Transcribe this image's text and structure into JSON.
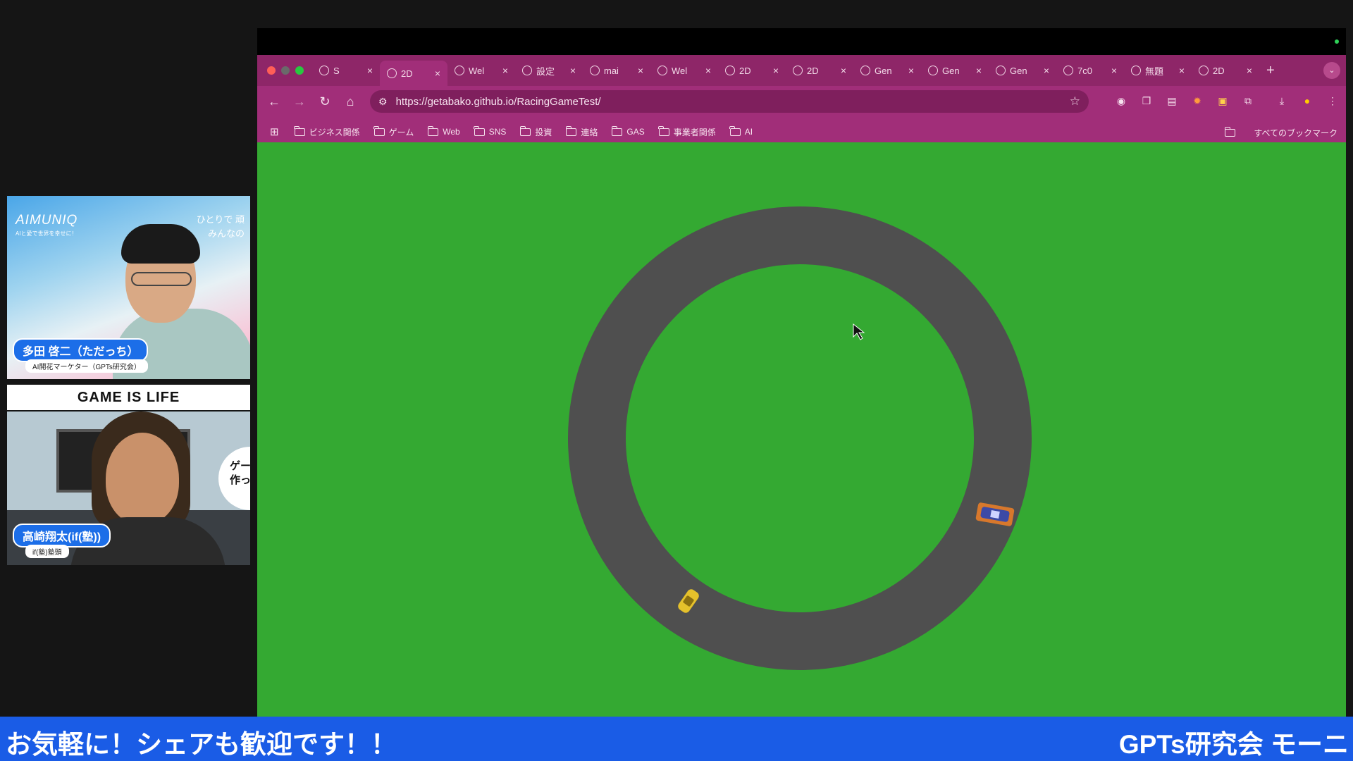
{
  "browser": {
    "tabs": [
      {
        "label": "S",
        "icon": "game-favicon-icon"
      },
      {
        "label": "2D",
        "icon": "globe-icon",
        "active": true
      },
      {
        "label": "Wel",
        "icon": "globe-icon"
      },
      {
        "label": "設定",
        "icon": "gear-icon"
      },
      {
        "label": "mai",
        "icon": "globe-icon"
      },
      {
        "label": "Wel",
        "icon": "globe-icon"
      },
      {
        "label": "2D",
        "icon": "globe-icon"
      },
      {
        "label": "2D",
        "icon": "globe-icon"
      },
      {
        "label": "Gen",
        "icon": "openai-icon"
      },
      {
        "label": "Gen",
        "icon": "openai-icon"
      },
      {
        "label": "Gen",
        "icon": "openai-icon"
      },
      {
        "label": "7c0",
        "icon": "globe-icon"
      },
      {
        "label": "無題",
        "icon": "globe-icon"
      },
      {
        "label": "2D",
        "icon": "globe-icon"
      }
    ],
    "url": "https://getabako.github.io/RacingGameTest/",
    "bookmarks": [
      "ビジネス関係",
      "ゲーム",
      "Web",
      "SNS",
      "投資",
      "連絡",
      "GAS",
      "事業者関係",
      "AI"
    ],
    "all_bookmarks": "すべてのブックマーク",
    "theme_color": "#a12e79"
  },
  "game": {
    "background_color": "#34a932",
    "track_color": "#4f4f4f",
    "cars": [
      {
        "name": "yellow-car",
        "color": "#e5c12b"
      },
      {
        "name": "blue-car",
        "color": "#3c4aa6"
      }
    ]
  },
  "cams": {
    "cam1": {
      "logo": "AIMUNIQ",
      "logo_sub": "AIと愛で世界を幸せに！",
      "tagline_1": "ひとりで 頑",
      "tagline_2": "みんなの",
      "name": "多田 啓二（ただっち）",
      "title": "AI開花マーケター（GPTs研究会）"
    },
    "banner": "GAME IS LIFE",
    "cam2": {
      "bubble_1": "ゲー",
      "bubble_2": "作って",
      "name": "高崎翔太(if(塾))",
      "title": "if(塾)塾頭"
    }
  },
  "ticker": {
    "left": "お気軽に！シェアも歓迎です！！",
    "right": "GPTs研究会 モーニ",
    "color": "#1a5ce6"
  }
}
